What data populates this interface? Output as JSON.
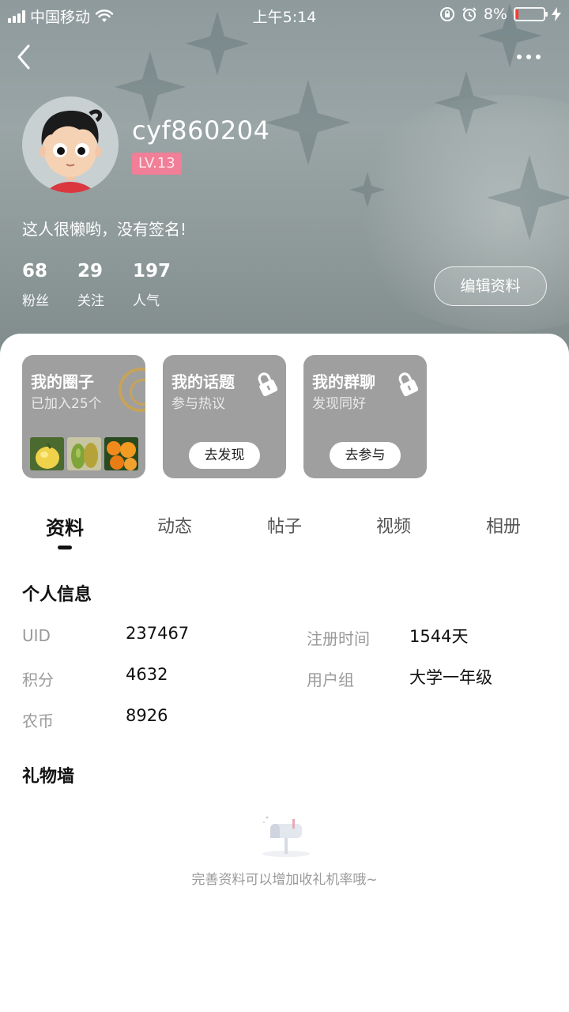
{
  "status_bar": {
    "carrier": "中国移动",
    "time": "上午5:14",
    "battery_percent": "8%",
    "battery_level": 0.08
  },
  "profile": {
    "username": "cyf860204",
    "level": "LV.13",
    "signature": "这人很懒哟，没有签名!",
    "stats": [
      {
        "value": "68",
        "label": "粉丝"
      },
      {
        "value": "29",
        "label": "关注"
      },
      {
        "value": "197",
        "label": "人气"
      }
    ],
    "edit_button": "编辑资料"
  },
  "feature_cards": [
    {
      "title": "我的圈子",
      "subtitle": "已加入25个",
      "locked": false
    },
    {
      "title": "我的话题",
      "subtitle": "参与热议",
      "action": "去发现",
      "locked": true
    },
    {
      "title": "我的群聊",
      "subtitle": "发现同好",
      "action": "去参与",
      "locked": true
    }
  ],
  "tabs": [
    "资料",
    "动态",
    "帖子",
    "视频",
    "相册"
  ],
  "active_tab": "资料",
  "personal_info": {
    "title": "个人信息",
    "fields": [
      {
        "label": "UID",
        "value": "237467"
      },
      {
        "label": "注册时间",
        "value": "1544天"
      },
      {
        "label": "积分",
        "value": "4632"
      },
      {
        "label": "用户组",
        "value": "大学一年级"
      },
      {
        "label": "农币",
        "value": "8926"
      }
    ]
  },
  "gift_wall": {
    "title": "礼物墙",
    "empty_text": "完善资料可以增加收礼机率哦~"
  },
  "colors": {
    "level_badge": "#f07f97",
    "card_bg": "#9f9f9f",
    "battery_low": "#ff3b30"
  }
}
